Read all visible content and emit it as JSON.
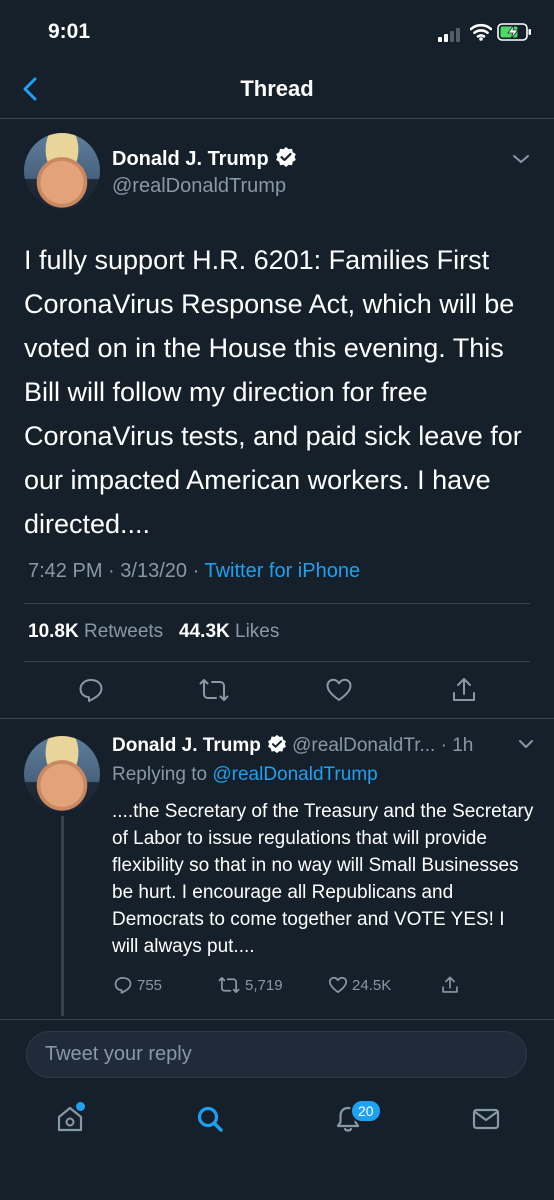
{
  "status_bar": {
    "time": "9:01",
    "icons": [
      "signal-icon",
      "wifi-icon",
      "battery-charging-icon"
    ]
  },
  "header": {
    "title": "Thread",
    "back_icon": "chevron-left-icon"
  },
  "main_tweet": {
    "author_name": "Donald J. Trump",
    "handle": "@realDonaldTrump",
    "text": "I fully support H.R. 6201: Families First CoronaVirus Response Act, which will be voted on in the House this evening. This Bill will follow my direction for free CoronaVirus tests, and paid sick leave for our impacted American workers. I have directed....",
    "time": "7:42 PM",
    "date": "3/13/20",
    "separator": "·",
    "source": "Twitter for iPhone",
    "retweets_count": "10.8K",
    "retweets_label": "Retweets",
    "likes_count": "44.3K",
    "likes_label": "Likes"
  },
  "reply_tweet": {
    "author_name": "Donald J. Trump",
    "handle": "@realDonaldTr...",
    "age": "· 1h",
    "replying_prefix": "Replying to",
    "replying_to": "@realDonaldTrump",
    "text": "....the Secretary of the Treasury and the Secretary of Labor to issue regulations that will provide flexibility so that in no way will Small Businesses be hurt. I encourage all Republicans and Democrats to come together and VOTE YES! I will always put....",
    "replies": "755",
    "retweets": "5,719",
    "likes": "24.5K"
  },
  "composer": {
    "placeholder": "Tweet your reply"
  },
  "tab_bar": {
    "notifications_badge": "20"
  },
  "colors": {
    "background": "#15202b",
    "accent": "#1da1f2",
    "secondary_text": "#8899a6",
    "divider": "#38444d"
  }
}
